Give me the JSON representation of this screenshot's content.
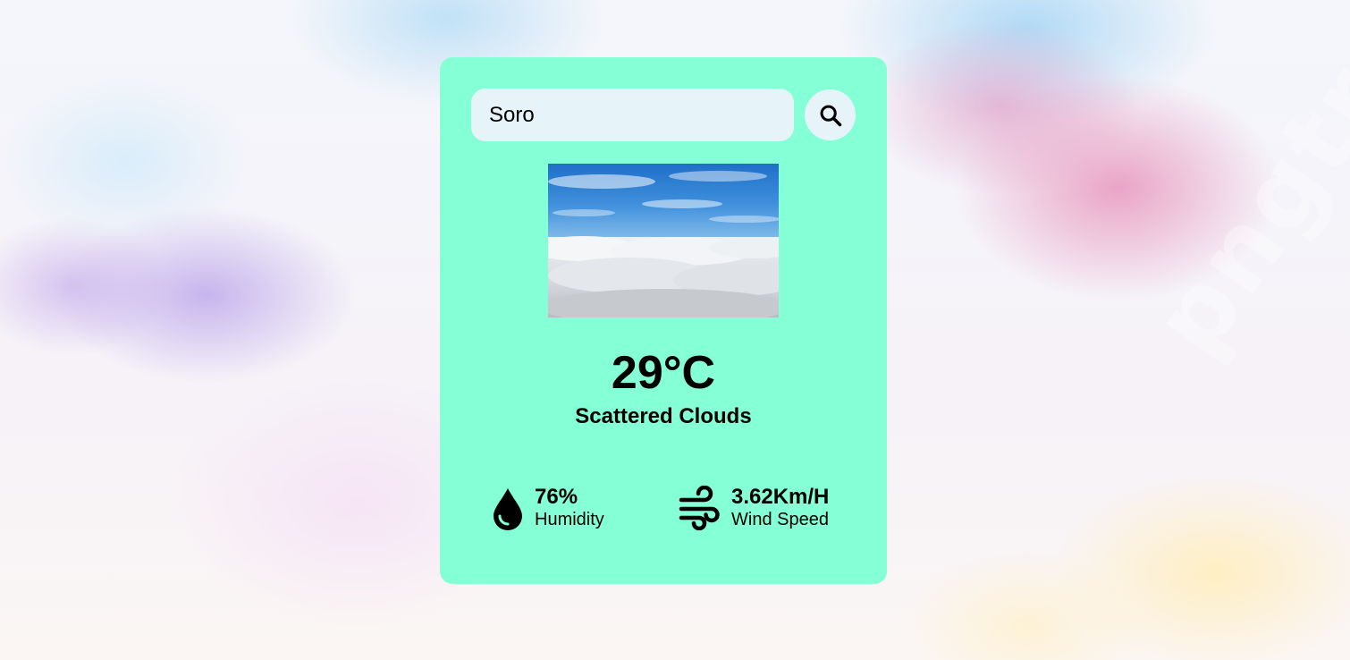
{
  "search": {
    "value": "Soro",
    "button_icon": "search-icon"
  },
  "weather": {
    "image_icon": "clouds-photo",
    "temperature": "29°C",
    "description": "Scattered Clouds"
  },
  "stats": {
    "humidity": {
      "value": "76%",
      "label": "Humidity",
      "icon": "water-drop-icon"
    },
    "wind": {
      "value": "3.62Km/H",
      "label": "Wind Speed",
      "icon": "wind-icon"
    }
  },
  "colors": {
    "card": "#84ffd6",
    "input": "#e6f4f9",
    "text": "#000000"
  }
}
